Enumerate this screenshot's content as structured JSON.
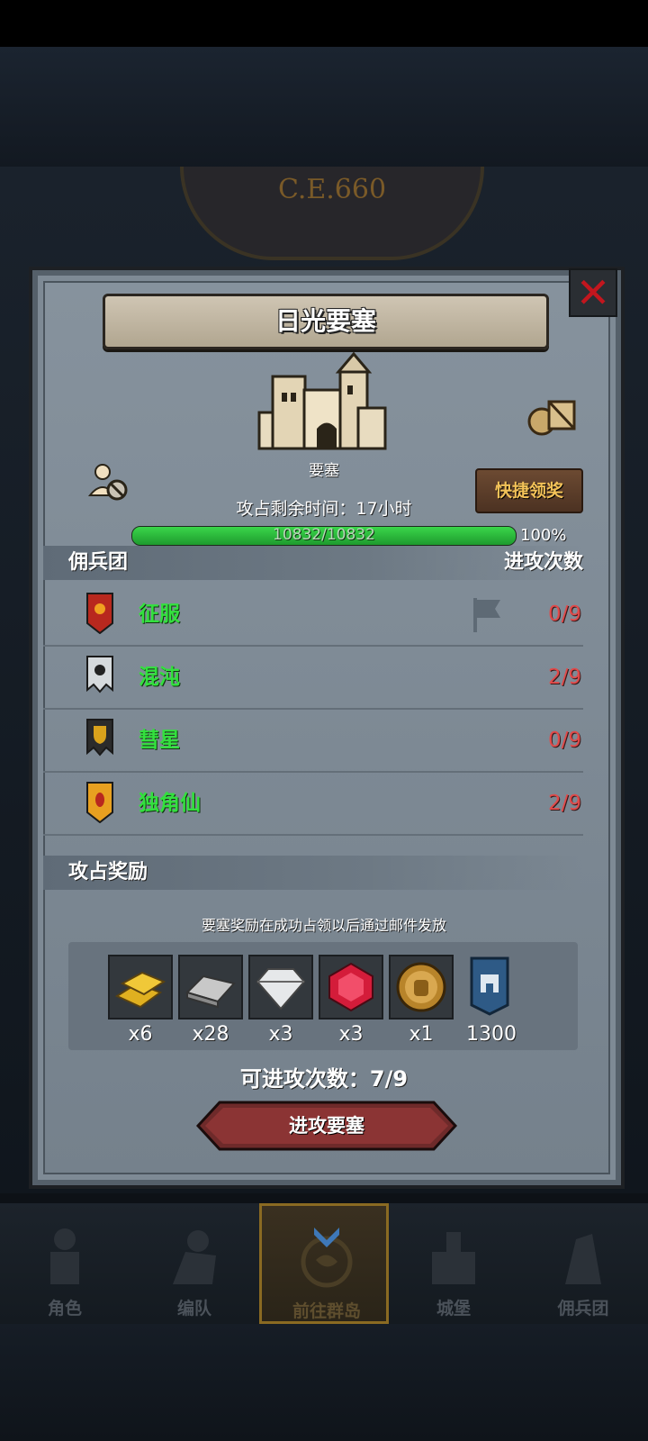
{
  "era": "C.E.660",
  "dialog": {
    "title": "日光要塞",
    "castle_label": "要塞",
    "quick_claim": "快捷领奖",
    "remaining_time": "攻占剩余时间：17小时",
    "hp": {
      "text": "10832/10832",
      "current": 10832,
      "max": 10832,
      "percent_label": "100%"
    },
    "mercenary_header": "佣兵团",
    "attack_count_header": "进攻次数",
    "mercenaries": [
      {
        "name": "征服",
        "count": "0/9",
        "icon": "sun-banner-icon",
        "color": "#c0392b"
      },
      {
        "name": "混沌",
        "count": "2/9",
        "icon": "skull-banner-icon",
        "color": "#bfc4c8"
      },
      {
        "name": "彗星",
        "count": "0/9",
        "icon": "shield-banner-icon",
        "color": "#d9a21c"
      },
      {
        "name": "独角仙",
        "count": "2/9",
        "icon": "beetle-banner-icon",
        "color": "#e8a020"
      }
    ],
    "rewards_header": "攻占奖励",
    "reward_note": "要塞奖励在成功占领以后通过邮件发放",
    "rewards": [
      {
        "icon": "gold-bars-icon",
        "qty": "x6"
      },
      {
        "icon": "iron-ingot-icon",
        "qty": "x28"
      },
      {
        "icon": "diamond-icon",
        "qty": "x3"
      },
      {
        "icon": "ruby-icon",
        "qty": "x3"
      },
      {
        "icon": "knight-medal-icon",
        "qty": "x1"
      },
      {
        "icon": "fortress-banner-icon",
        "qty": "1300"
      }
    ],
    "attempts": "可进攻次数：7/9",
    "attack_button": "进攻要塞"
  },
  "nav": [
    {
      "label": "角色",
      "icon": "character-icon",
      "active": false
    },
    {
      "label": "编队",
      "icon": "formation-icon",
      "active": false
    },
    {
      "label": "前往群岛",
      "icon": "islands-icon",
      "active": true
    },
    {
      "label": "城堡",
      "icon": "castle-icon",
      "active": false
    },
    {
      "label": "佣兵团",
      "icon": "mercenary-icon",
      "active": false
    }
  ]
}
